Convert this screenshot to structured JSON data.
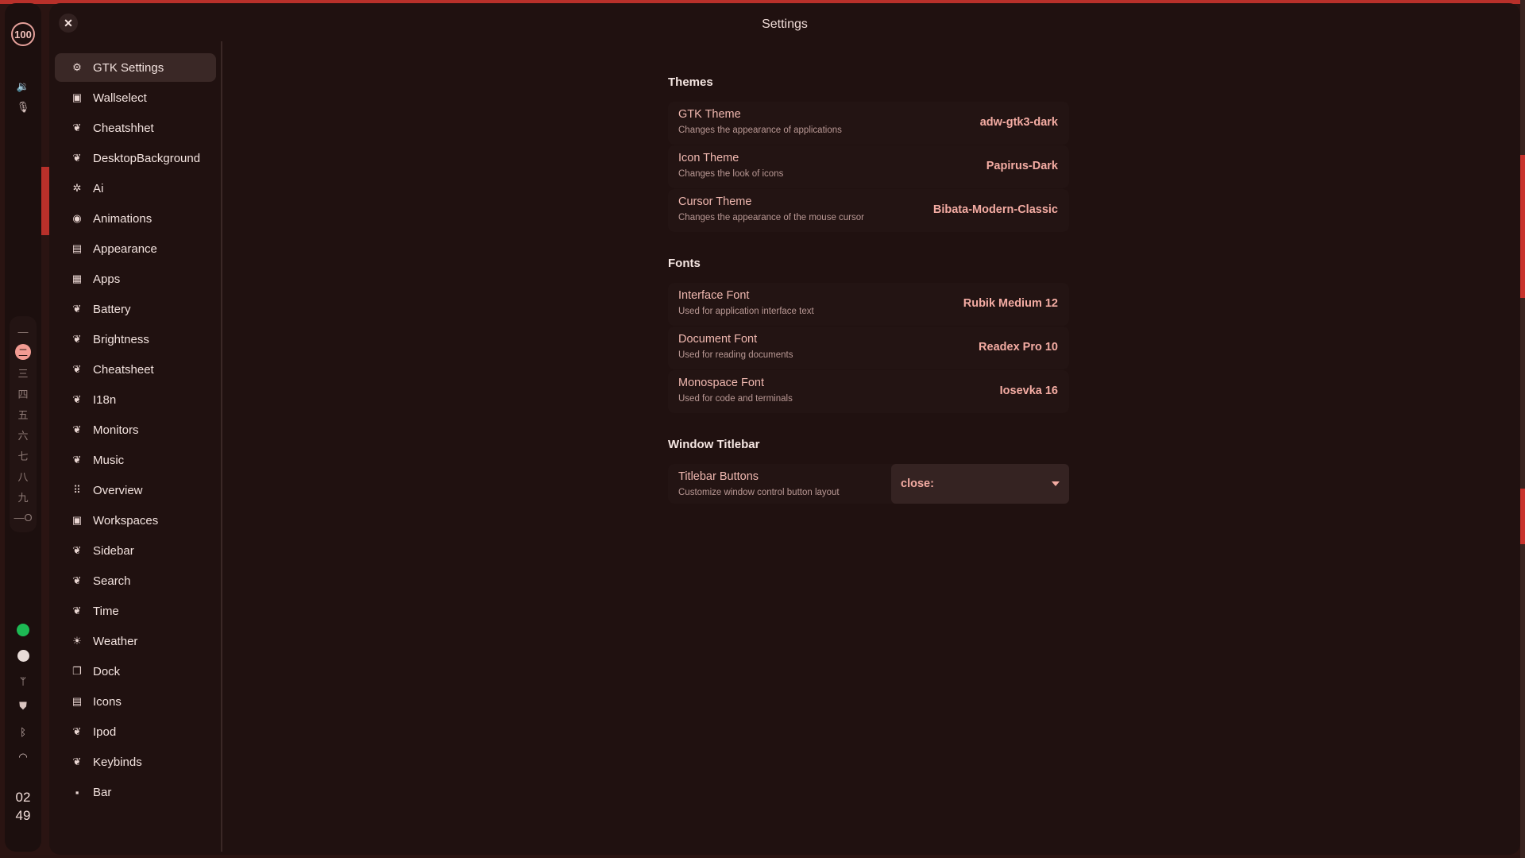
{
  "rail": {
    "badge": "100",
    "top_icons": [
      "volume-icon",
      "microphone-icon"
    ],
    "workspaces": [
      "—",
      "二",
      "三",
      "四",
      "五",
      "六",
      "七",
      "八",
      "九",
      "—O"
    ],
    "active_workspace_index": 1,
    "tray_icons": [
      "spotify-icon",
      "steam-icon",
      "usb-icon",
      "shield-icon",
      "bluetooth-icon",
      "wifi-icon"
    ],
    "clock_hour": "02",
    "clock_minute": "49",
    "colors": {
      "accent": "#f29b92",
      "spotify": "#1db954"
    }
  },
  "window": {
    "title": "Settings",
    "close_glyph": "✕"
  },
  "sidebar": {
    "items": [
      {
        "label": "GTK Settings",
        "icon": "palette-icon",
        "glyph": "⚙"
      },
      {
        "label": "Wallselect",
        "icon": "monitor-icon",
        "glyph": "▣"
      },
      {
        "label": "Cheatshhet",
        "icon": "widget-icon",
        "glyph": "❦"
      },
      {
        "label": "DesktopBackground",
        "icon": "widget-icon",
        "glyph": "❦"
      },
      {
        "label": "Ai",
        "icon": "gear-icon",
        "glyph": "✲"
      },
      {
        "label": "Animations",
        "icon": "eye-icon",
        "glyph": "◉"
      },
      {
        "label": "Appearance",
        "icon": "image-icon",
        "glyph": "▤"
      },
      {
        "label": "Apps",
        "icon": "apps-icon",
        "glyph": "▦"
      },
      {
        "label": "Battery",
        "icon": "widget-icon",
        "glyph": "❦"
      },
      {
        "label": "Brightness",
        "icon": "widget-icon",
        "glyph": "❦"
      },
      {
        "label": "Cheatsheet",
        "icon": "widget-icon",
        "glyph": "❦"
      },
      {
        "label": "I18n",
        "icon": "widget-icon",
        "glyph": "❦"
      },
      {
        "label": "Monitors",
        "icon": "widget-icon",
        "glyph": "❦"
      },
      {
        "label": "Music",
        "icon": "widget-icon",
        "glyph": "❦"
      },
      {
        "label": "Overview",
        "icon": "grid-dots-icon",
        "glyph": "⠿"
      },
      {
        "label": "Workspaces",
        "icon": "workspaces-icon",
        "glyph": "▣"
      },
      {
        "label": "Sidebar",
        "icon": "widget-icon",
        "glyph": "❦"
      },
      {
        "label": "Search",
        "icon": "widget-icon",
        "glyph": "❦"
      },
      {
        "label": "Time",
        "icon": "widget-icon",
        "glyph": "❦"
      },
      {
        "label": "Weather",
        "icon": "weather-icon",
        "glyph": "☀"
      },
      {
        "label": "Dock",
        "icon": "dock-icon",
        "glyph": "❐"
      },
      {
        "label": "Icons",
        "icon": "image-icon",
        "glyph": "▤"
      },
      {
        "label": "Ipod",
        "icon": "widget-icon",
        "glyph": "❦"
      },
      {
        "label": "Keybinds",
        "icon": "widget-icon",
        "glyph": "❦"
      },
      {
        "label": "Bar",
        "icon": "grid-icon",
        "glyph": "▪"
      }
    ]
  },
  "content": {
    "themes": {
      "title": "Themes",
      "rows": [
        {
          "label": "GTK Theme",
          "desc": "Changes the appearance of applications",
          "value": "adw-gtk3-dark"
        },
        {
          "label": "Icon Theme",
          "desc": "Changes the look of icons",
          "value": "Papirus-Dark"
        },
        {
          "label": "Cursor Theme",
          "desc": "Changes the appearance of the mouse cursor",
          "value": "Bibata-Modern-Classic"
        }
      ]
    },
    "fonts": {
      "title": "Fonts",
      "rows": [
        {
          "label": "Interface Font",
          "desc": "Used for application interface text",
          "value": "Rubik Medium 12"
        },
        {
          "label": "Document Font",
          "desc": "Used for reading documents",
          "value": "Readex Pro 10"
        },
        {
          "label": "Monospace Font",
          "desc": "Used for code and terminals",
          "value": "Iosevka 16"
        }
      ]
    },
    "titlebar": {
      "title": "Window Titlebar",
      "row": {
        "label": "Titlebar Buttons",
        "desc": "Customize window control button layout",
        "value": "close:"
      }
    }
  }
}
